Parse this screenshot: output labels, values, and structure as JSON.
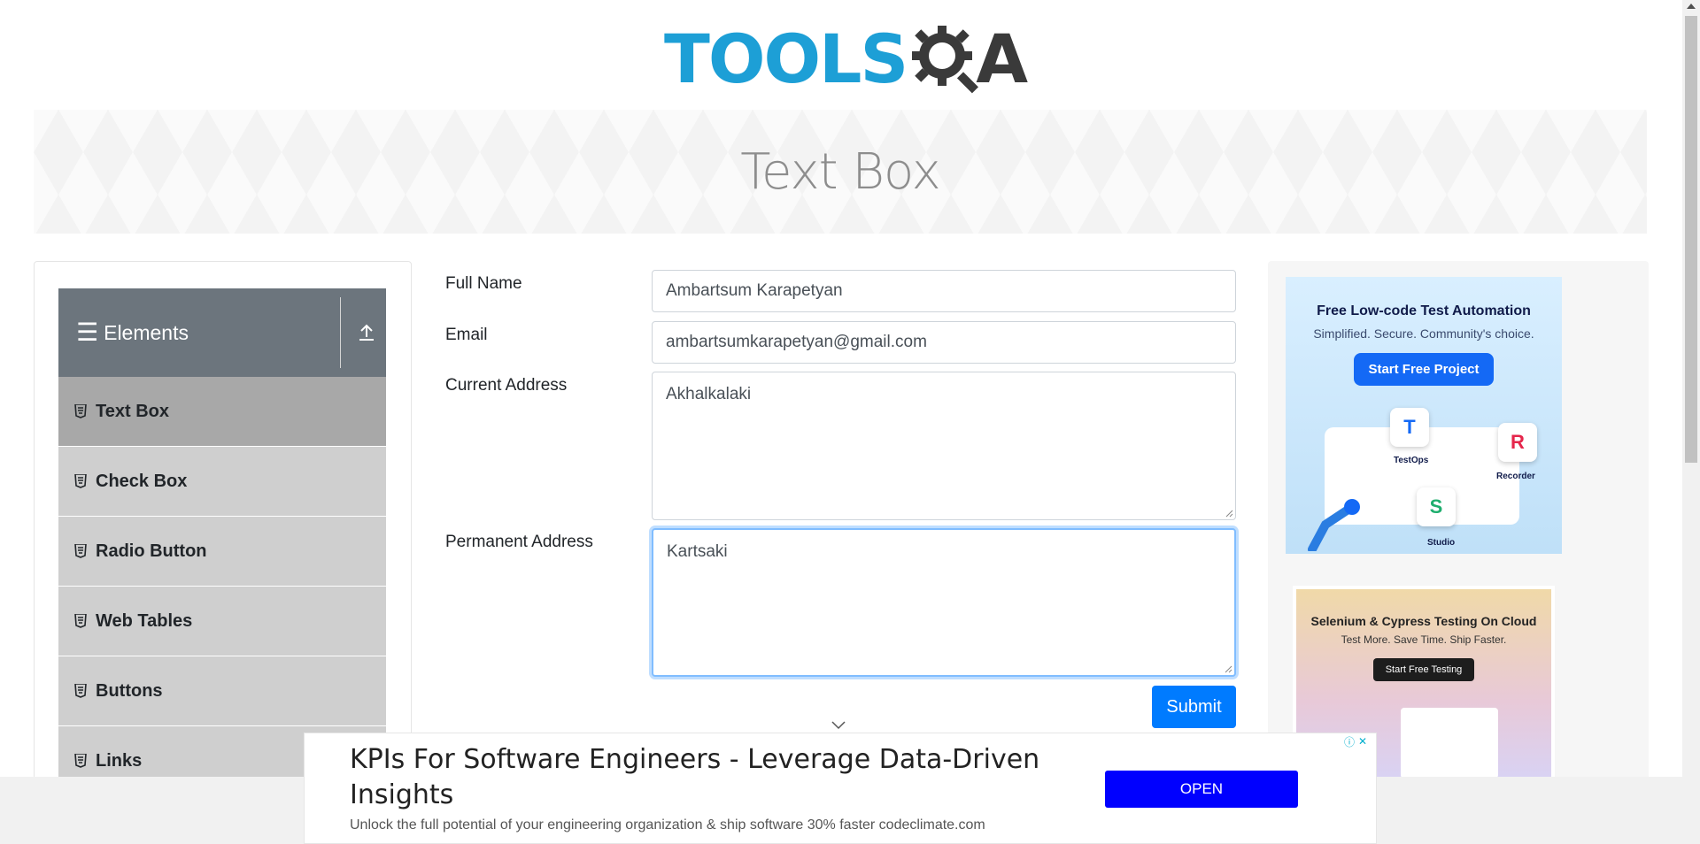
{
  "header": {
    "logo_text": "TOOLS",
    "logo_text_suffix": "A"
  },
  "page": {
    "title": "Text Box"
  },
  "sidebar": {
    "group_title": "Elements",
    "items": [
      {
        "label": "Text Box",
        "active": true
      },
      {
        "label": "Check Box",
        "active": false
      },
      {
        "label": "Radio Button",
        "active": false
      },
      {
        "label": "Web Tables",
        "active": false
      },
      {
        "label": "Buttons",
        "active": false
      },
      {
        "label": "Links",
        "active": false
      }
    ]
  },
  "form": {
    "full_name_label": "Full Name",
    "full_name_value": "Ambartsum Karapetyan",
    "email_label": "Email",
    "email_value": "ambartsumkarapetyan@gmail.com",
    "current_address_label": "Current Address",
    "current_address_value": "Akhalkalaki",
    "permanent_address_label": "Permanent Address",
    "permanent_address_value": "Kartsaki",
    "submit_label": "Submit"
  },
  "ads": {
    "ad1": {
      "headline": "Free Low-code Test Automation",
      "subline": "Simplified. Secure. Community's choice.",
      "button": "Start Free Project",
      "tile_testops": "TestOps",
      "tile_recorder": "Recorder",
      "tile_studio": "Studio"
    },
    "ad2": {
      "headline": "Selenium & Cypress Testing On Cloud",
      "subline": "Test More. Save Time. Ship Faster.",
      "button": "Start Free Testing"
    },
    "bottom": {
      "headline": "KPIs For Software Engineers - Leverage Data-Driven Insights",
      "subline": "Unlock the full potential of your engineering organization & ship software 30% faster codeclimate.com",
      "button": "OPEN"
    }
  },
  "colors": {
    "logo_blue": "#1d9fd6",
    "sidebar_header": "#6c757d",
    "active_item": "#a8a8a8",
    "primary": "#007bff",
    "ad_open_button": "#0000ff"
  }
}
